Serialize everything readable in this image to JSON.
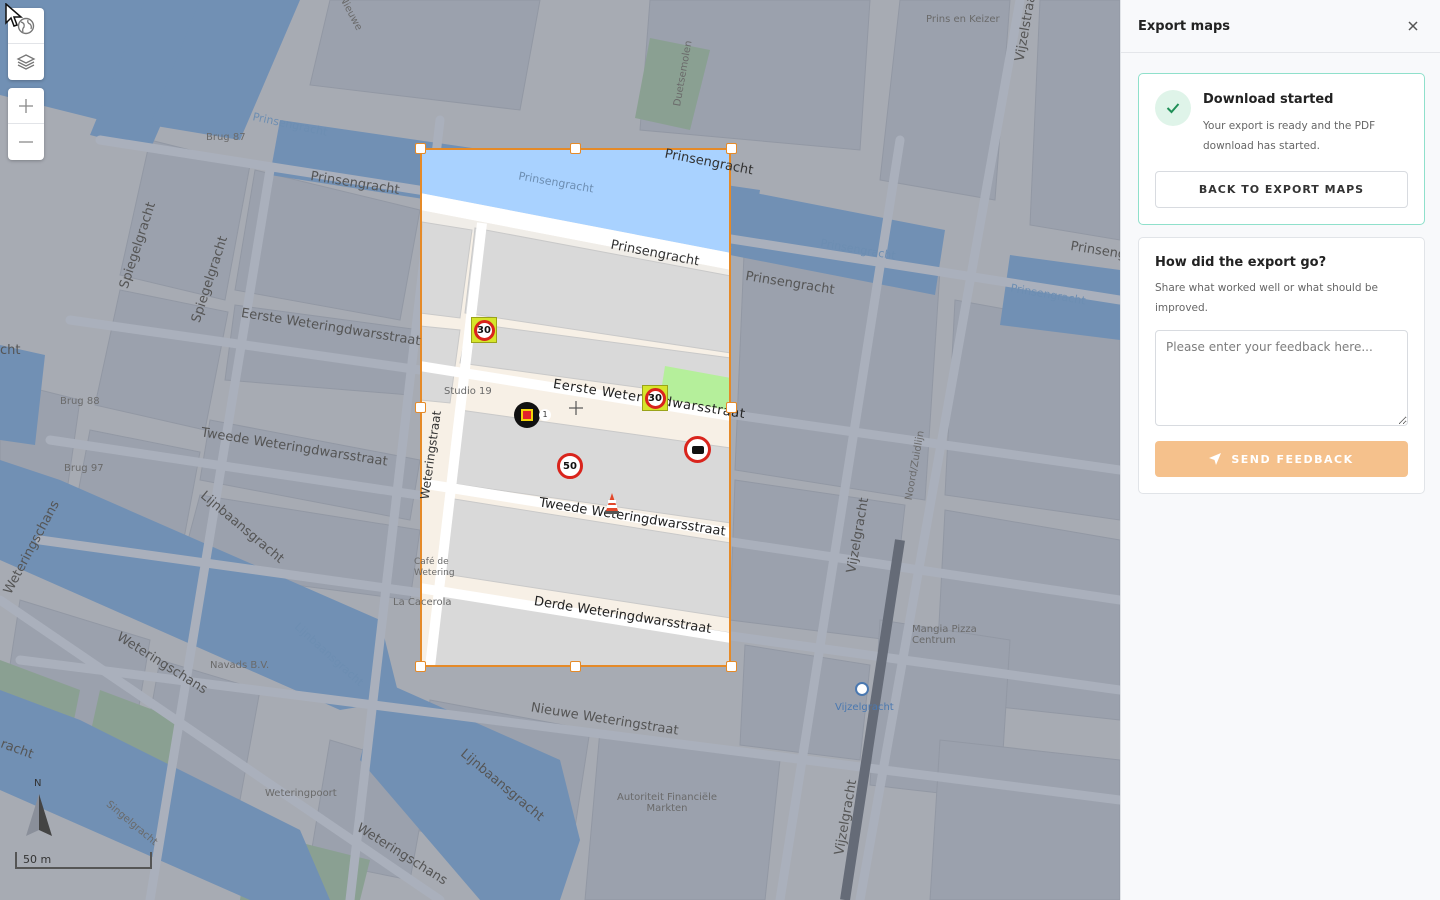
{
  "panel": {
    "title": "Export maps",
    "success": {
      "title": "Download started",
      "description": "Your export is ready and the PDF download has started.",
      "back_button": "BACK TO EXPORT MAPS"
    },
    "feedback": {
      "title": "How did the export go?",
      "description": "Share what worked well or what should be improved.",
      "placeholder": "Please enter your feedback here...",
      "send_button": "SEND FEEDBACK"
    }
  },
  "map": {
    "scale_label": "50 m",
    "north_label": "N",
    "signs": {
      "speed_30": "30",
      "speed_50": "50",
      "cluster_count": "1"
    },
    "labels": {
      "prinsengracht": "Prinsengracht",
      "brug_87": "Brug 87",
      "brug_88": "Brug 88",
      "brug_97": "Brug 97",
      "spiegelgracht": "Spiegelgracht",
      "eerste": "Eerste Weteringdwarsstraat",
      "tweede": "Tweede Weteringdwarsstraat",
      "derde": "Derde Weteringdwarsstraat",
      "weteringstraat": "Weteringstraat",
      "weteringschans": "Weteringschans",
      "lijnbaansgracht": "Lijnbaansgracht",
      "nieuwe_weteringstraat": "Nieuwe Weteringstraat",
      "vijzelgracht": "Vijzelgracht",
      "vijzelstraat": "Vijzelstraat",
      "noordzuidlijn": "Noord/Zuidlijn",
      "prins_en_keizer": "Prins en Keizer",
      "nieuwe": "Nieuwe",
      "studio_19": "Studio 19",
      "cafe_wetering": "Café de Wetering",
      "la_cacerola": "La Cacerola",
      "navads": "Navads B.V.",
      "weteringpoort": "Weteringpoort",
      "mangia": "Mangia Pizza Centrum",
      "afm": "Autoriteit Financiële Markten",
      "vijzelgracht_station": "Vijzelgracht",
      "singelgracht": "Singelgracht",
      "duetsemolen": "Duetsemolen",
      "cht": "cht",
      "racht": "racht"
    }
  }
}
